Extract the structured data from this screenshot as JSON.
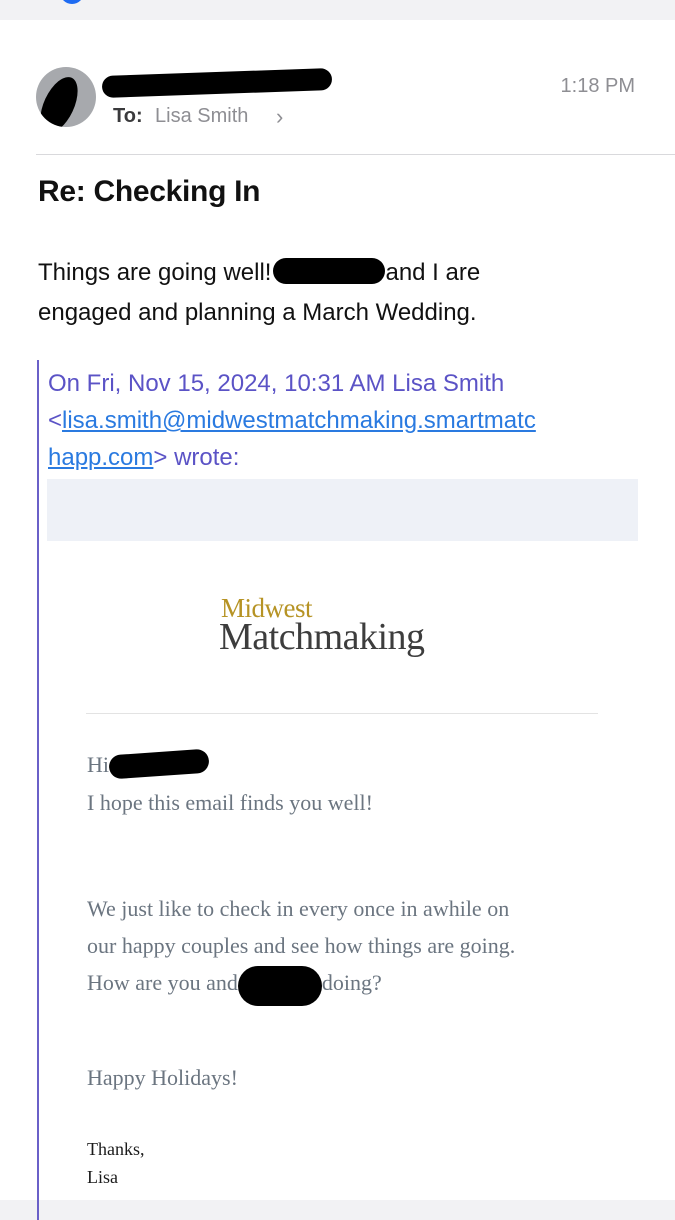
{
  "header": {
    "to_label": "To:",
    "recipient": "Lisa Smith",
    "chevron": "›",
    "time": "1:18 PM"
  },
  "subject": "Re: Checking In",
  "reply": {
    "line1_a": "Things are going well!",
    "line1_b": "and I are",
    "line2": "engaged and planning a March Wedding."
  },
  "quote": {
    "attribution": "On Fri, Nov 15, 2024, 10:31 AM Lisa Smith",
    "lt": "<",
    "email": "lisa.smith@midwestmatchmaking.smartmatchapp.com",
    "email_line1": "lisa.smith@midwestmatchmaking.smartmatc",
    "email_line2": "happ.com",
    "wrote": "> wrote:"
  },
  "logo": {
    "line1": "Midwest",
    "line2": "Matchmaking"
  },
  "message": {
    "greeting": "Hi",
    "hope": "I hope this email finds you well!",
    "checkin_1": "We just like to check in every once in awhile on",
    "checkin_2": "our happy couples and see how things are going.",
    "checkin_3a": "How are you and",
    "checkin_3b": "doing?",
    "holidays": "Happy Holidays!",
    "thanks": "Thanks,",
    "signature": "Lisa"
  },
  "colors": {
    "quote_accent": "#5b53c6",
    "link": "#2a7ae0",
    "logo_gold": "#b69324"
  },
  "icons": {
    "avatar": "avatar-icon",
    "chevron": "chevron-right-icon"
  }
}
